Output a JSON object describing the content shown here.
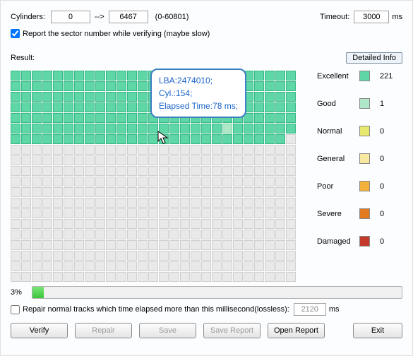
{
  "top": {
    "cylinders_label": "Cylinders:",
    "cyl_from": "0",
    "arrow": "-->",
    "cyl_to": "6467",
    "range": "(0-60801)",
    "timeout_label": "Timeout:",
    "timeout_val": "3000",
    "ms": "ms",
    "report_check": true,
    "report_label": "Report the sector number while verifying (maybe slow)"
  },
  "result_label": "Result:",
  "detailed_info_btn": "Detailed Info",
  "grid": {
    "cols": 27,
    "rows": 20,
    "excellent_end": 166,
    "good_cells": [
      155
    ],
    "last_row_partial": 26
  },
  "tooltip": {
    "line1": "LBA:2474010;",
    "line2": "Cyl.:154;",
    "line3": "Elapsed Time:78 ms;"
  },
  "legend": [
    {
      "name": "Excellent",
      "color": "#5ed6a6",
      "count": "221"
    },
    {
      "name": "Good",
      "color": "#aee8c8",
      "count": "1"
    },
    {
      "name": "Normal",
      "color": "#e6e96d",
      "count": "0"
    },
    {
      "name": "General",
      "color": "#f7eaa0",
      "count": "0"
    },
    {
      "name": "Poor",
      "color": "#f2b23b",
      "count": "0"
    },
    {
      "name": "Severe",
      "color": "#e27a1f",
      "count": "0"
    },
    {
      "name": "Damaged",
      "color": "#c33a2d",
      "count": "0"
    }
  ],
  "progress": {
    "pct": "3%",
    "val": 3
  },
  "repair_row": {
    "check": false,
    "label": "Repair normal tracks which time elapsed more than this millisecond(lossless):",
    "val": "2120",
    "ms": "ms"
  },
  "buttons": {
    "verify": "Verify",
    "repair": "Repair",
    "save": "Save",
    "save_report": "Save Report",
    "open_report": "Open Report",
    "exit": "Exit"
  }
}
